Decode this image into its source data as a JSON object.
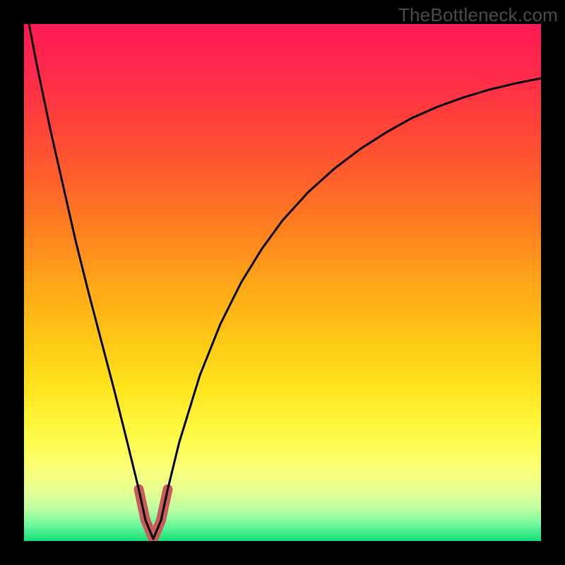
{
  "watermark": {
    "text": "TheBottleneck.com"
  },
  "gradient": {
    "stops": [
      {
        "offset": 0.0,
        "color": "#ff1a54"
      },
      {
        "offset": 0.1,
        "color": "#ff2b4a"
      },
      {
        "offset": 0.2,
        "color": "#ff4438"
      },
      {
        "offset": 0.3,
        "color": "#ff602a"
      },
      {
        "offset": 0.4,
        "color": "#ff8120"
      },
      {
        "offset": 0.5,
        "color": "#ffa518"
      },
      {
        "offset": 0.6,
        "color": "#ffc414"
      },
      {
        "offset": 0.7,
        "color": "#ffe41c"
      },
      {
        "offset": 0.8,
        "color": "#fffb48"
      },
      {
        "offset": 0.85,
        "color": "#fdff70"
      },
      {
        "offset": 0.9,
        "color": "#e9ff90"
      },
      {
        "offset": 0.94,
        "color": "#baffa2"
      },
      {
        "offset": 0.97,
        "color": "#6bf79c"
      },
      {
        "offset": 1.0,
        "color": "#13e07a"
      }
    ]
  },
  "chart_data": {
    "type": "line",
    "title": "",
    "xlabel": "",
    "ylabel": "",
    "xlim": [
      0,
      100
    ],
    "ylim": [
      0,
      100
    ],
    "series": [
      {
        "name": "bottleneck-curve",
        "x": [
          0,
          2.5,
          5,
          7.5,
          10,
          12.5,
          15,
          17.5,
          20,
          22.2,
          23.5,
          25,
          26.5,
          27.8,
          30,
          34,
          38,
          42,
          46,
          50,
          55,
          60,
          65,
          70,
          75,
          80,
          85,
          90,
          95,
          100
        ],
        "values": [
          105,
          92,
          80,
          69,
          58,
          48,
          38.5,
          29,
          19,
          10,
          4,
          0.4,
          4,
          10,
          19,
          32,
          42,
          50,
          56.5,
          62,
          67.5,
          72,
          75.8,
          79,
          81.8,
          84,
          85.8,
          87.3,
          88.5,
          89.5
        ]
      }
    ],
    "markers": {
      "name": "min-region",
      "color": "#ca5b5b",
      "x": [
        22.2,
        23.5,
        25,
        26.5,
        27.8
      ],
      "values": [
        10,
        4,
        0.4,
        4,
        10
      ]
    }
  },
  "styles": {
    "curve_stroke": "#000000",
    "curve_width": 3,
    "marker_stroke": "#ca5b5b",
    "marker_width": 14
  }
}
